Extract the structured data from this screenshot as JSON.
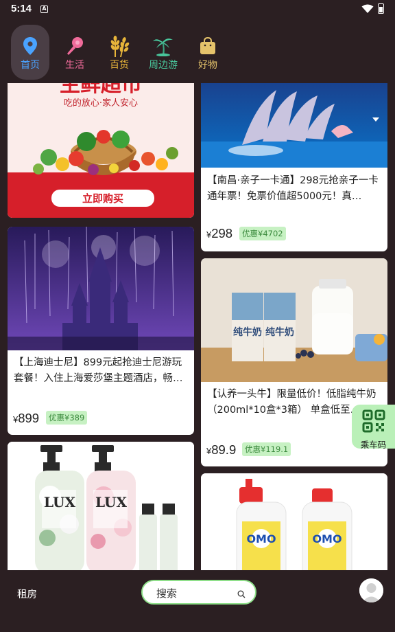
{
  "status_bar": {
    "time": "5:14",
    "notif_icon": "A"
  },
  "top_nav": {
    "items": [
      {
        "label": "首页",
        "icon": "location-pin-icon",
        "active": true
      },
      {
        "label": "生活",
        "icon": "microphone-icon"
      },
      {
        "label": "百货",
        "icon": "wheat-icon"
      },
      {
        "label": "周边游",
        "icon": "palm-tree-icon"
      },
      {
        "label": "好物",
        "icon": "shopping-bag-icon"
      }
    ]
  },
  "feed": {
    "left": [
      {
        "image_text": {
          "headline": "生鲜超市",
          "tagline": "吃的放心·家人安心",
          "cta": "立即购买"
        }
      },
      {
        "title": "【上海迪士尼】899元起抢迪士尼游玩套餐！入住上海爱莎堡主题酒店，畅…",
        "currency": "¥",
        "price": "899",
        "discount": "优惠¥389"
      },
      {
        "image_text": {
          "brand": "LUX"
        }
      }
    ],
    "right": [
      {
        "title": "【南昌·亲子一卡通】298元抢亲子一卡通年票！免票价值超5000元！真…",
        "currency": "¥",
        "price": "298",
        "discount": "优惠¥4702"
      },
      {
        "title": "【认养一头牛】限量低价！低脂纯牛奶 （200ml*10盒*3箱） 单盒低至…",
        "currency": "¥",
        "price": "89.9",
        "discount": "优惠¥119.1",
        "image_text": {
          "product": "纯牛奶"
        }
      },
      {
        "image_text": {
          "brand": "OMO"
        }
      }
    ]
  },
  "qr_button": {
    "label": "乘车码"
  },
  "bottom_bar": {
    "rent_label": "租房",
    "search_placeholder": "搜索"
  },
  "colors": {
    "background": "#2b1f22",
    "active_tab": "#4aa3ff",
    "badge_bg": "#c7f1c3",
    "badge_text": "#3b8a3d",
    "search_border": "#8fe08a"
  }
}
